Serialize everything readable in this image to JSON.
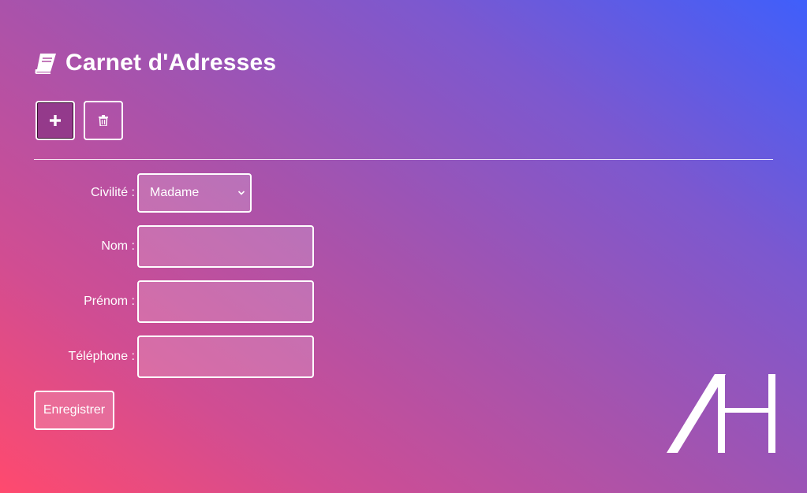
{
  "header": {
    "title": "Carnet d'Adresses",
    "icon": "book-icon"
  },
  "toolbar": {
    "add": {
      "icon": "plus-icon",
      "active": true
    },
    "delete": {
      "icon": "trash-icon",
      "active": false
    }
  },
  "form": {
    "civilite": {
      "label": "Civilité :",
      "value": "Madame"
    },
    "nom": {
      "label": "Nom :",
      "value": ""
    },
    "prenom": {
      "label": "Prénom :",
      "value": ""
    },
    "telephone": {
      "label": "Téléphone :",
      "value": ""
    },
    "submit_label": "Enregistrer"
  },
  "colors": {
    "gradient_start": "#ff4a6e",
    "gradient_mid": "#a653ad",
    "gradient_end": "#3f5ffb",
    "foreground": "#ffffff"
  }
}
